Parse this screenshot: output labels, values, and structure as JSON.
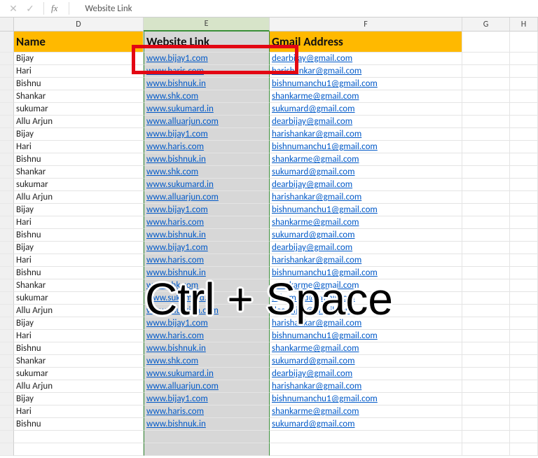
{
  "formula_bar": {
    "cell_content": "Website Link"
  },
  "columns": {
    "D": "D",
    "E": "E",
    "F": "F",
    "G": "G",
    "H": "H"
  },
  "headers": {
    "name": "Name",
    "website": "Website Link",
    "gmail": "Gmail Address"
  },
  "overlay": "Ctrl + Space",
  "rows": [
    {
      "name": "Bijay",
      "website": "www.bijay1.com",
      "gmail": "dearbijay@gmail.com"
    },
    {
      "name": "Hari",
      "website": "www.haris.com",
      "gmail": "harishankar@gmail.com"
    },
    {
      "name": "Bishnu",
      "website": "www.bishnuk.in",
      "gmail": "bishnumanchu1@gmail.com"
    },
    {
      "name": "Shankar",
      "website": "www.shk.com",
      "gmail": "shankarme@gmail.com"
    },
    {
      "name": "sukumar",
      "website": "www.sukumard.in",
      "gmail": "sukumard@gmail.com"
    },
    {
      "name": "Allu Arjun",
      "website": "www.alluarjun.com",
      "gmail": "dearbijay@gmail.com"
    },
    {
      "name": "Bijay",
      "website": "www.bijay1.com",
      "gmail": "harishankar@gmail.com"
    },
    {
      "name": "Hari",
      "website": "www.haris.com",
      "gmail": "bishnumanchu1@gmail.com"
    },
    {
      "name": "Bishnu",
      "website": "www.bishnuk.in",
      "gmail": "shankarme@gmail.com"
    },
    {
      "name": "Shankar",
      "website": "www.shk.com",
      "gmail": "sukumard@gmail.com"
    },
    {
      "name": "sukumar",
      "website": "www.sukumard.in",
      "gmail": "dearbijay@gmail.com"
    },
    {
      "name": "Allu Arjun",
      "website": "www.alluarjun.com",
      "gmail": "harishankar@gmail.com"
    },
    {
      "name": "Bijay",
      "website": "www.bijay1.com",
      "gmail": "bishnumanchu1@gmail.com"
    },
    {
      "name": "Hari",
      "website": "www.haris.com",
      "gmail": "shankarme@gmail.com"
    },
    {
      "name": "Bishnu",
      "website": "www.bishnuk.in",
      "gmail": "sukumard@gmail.com"
    },
    {
      "name": "Bijay",
      "website": "www.bijay1.com",
      "gmail": "dearbijay@gmail.com"
    },
    {
      "name": "Hari",
      "website": "www.haris.com",
      "gmail": "harishankar@gmail.com"
    },
    {
      "name": "Bishnu",
      "website": "www.bishnuk.in",
      "gmail": "bishnumanchu1@gmail.com"
    },
    {
      "name": "Shankar",
      "website": "www.shk.com",
      "gmail": "shankarme@gmail.com"
    },
    {
      "name": "sukumar",
      "website": "www.sukumard.in",
      "gmail": "sukumard@gmail.com"
    },
    {
      "name": "Allu Arjun",
      "website": "www.alluarjun.com",
      "gmail": "dearbijay@gmail.com"
    },
    {
      "name": "Bijay",
      "website": "www.bijay1.com",
      "gmail": "harishankar@gmail.com"
    },
    {
      "name": "Hari",
      "website": "www.haris.com",
      "gmail": "bishnumanchu1@gmail.com"
    },
    {
      "name": "Bishnu",
      "website": "www.bishnuk.in",
      "gmail": "shankarme@gmail.com"
    },
    {
      "name": "Shankar",
      "website": "www.shk.com",
      "gmail": "sukumard@gmail.com"
    },
    {
      "name": "sukumar",
      "website": "www.sukumard.in",
      "gmail": "dearbijay@gmail.com"
    },
    {
      "name": "Allu Arjun",
      "website": "www.alluarjun.com",
      "gmail": "harishankar@gmail.com"
    },
    {
      "name": "Bijay",
      "website": "www.bijay1.com",
      "gmail": "bishnumanchu1@gmail.com"
    },
    {
      "name": "Hari",
      "website": "www.haris.com",
      "gmail": "shankarme@gmail.com"
    },
    {
      "name": "Bishnu",
      "website": "www.bishnuk.in",
      "gmail": "sukumard@gmail.com"
    }
  ]
}
